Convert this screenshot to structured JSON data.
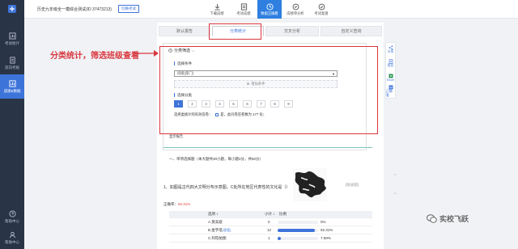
{
  "sidebar": {
    "items": [
      {
        "label": "考试统计",
        "icon": "chart-icon"
      },
      {
        "label": "双向考核",
        "icon": "document-icon"
      },
      {
        "label": "成绩&数据",
        "icon": "data-icon",
        "active": true
      }
    ],
    "bottom": [
      {
        "label": "帮助中心",
        "icon": "help-icon"
      },
      {
        "label": "帮助中心",
        "icon": "user-icon"
      }
    ]
  },
  "topbar": {
    "exam_title": "历史九年级全一模综合测试(ID 37473213)",
    "switch_label": "切换考试",
    "tools": [
      {
        "label": "下载成绩",
        "icon": "download-icon"
      },
      {
        "label": "考试成绩",
        "icon": "grade-icon"
      },
      {
        "label": "数据正确看",
        "icon": "clock-icon",
        "active": true
      },
      {
        "label": "成绩单分析",
        "icon": "analysis-icon"
      },
      {
        "label": "考试复盘",
        "icon": "check-icon"
      }
    ]
  },
  "tabs": [
    {
      "label": "默认报告"
    },
    {
      "label": "分类统计",
      "active": true
    },
    {
      "label": "交叉分析"
    },
    {
      "label": "自定义查询"
    }
  ],
  "filter": {
    "header": "分类筛选",
    "condition_label": "选择条件",
    "select_value": "班级(部门)",
    "add_condition": "增加条件",
    "classify_label": "选择分类",
    "numbers": [
      "1",
      "2",
      "3",
      "4",
      "5",
      "6",
      "7",
      "8",
      "9"
    ],
    "active_number": "1",
    "valid_label": "选择类统计的有效答卷：",
    "valid_value": "是，此问卷答卷数为 177 份；"
  },
  "annotation": "分类统计，筛选班级查看",
  "report_mark": "显示报告",
  "section_head": "一、单项选择题（本大题共30小题，每小题2分，共60分）",
  "question": "1、如图是古代四大文明分布示意图，C处所在地区代表性的文化是（）",
  "collect_label": "[收录题]",
  "accuracy": {
    "label": "正确率：",
    "value": "92.31%"
  },
  "table": {
    "headers": [
      "选项 ↕",
      "小计 ↕",
      "比例"
    ],
    "rows": [
      {
        "option": "A.莫高窟",
        "count": "0",
        "pct": "0%",
        "ratio": 0,
        "tag": ""
      },
      {
        "option": "B.金字塔",
        "count": "12",
        "pct": "92.31%",
        "ratio": 0.9231,
        "tag": "(答案)"
      },
      {
        "option": "C.阿旺帕图",
        "count": "1",
        "pct": "7.69%",
        "ratio": 0.0769,
        "tag": ""
      }
    ]
  },
  "right_tools": [
    {
      "label": "分享",
      "icon": "share-icon"
    },
    {
      "label": "报告",
      "icon": "report-icon"
    },
    {
      "label": "Excel",
      "icon": "excel-icon"
    },
    {
      "label": "正确看",
      "icon": "word-icon"
    }
  ],
  "watermark": "实校飞跃",
  "colors": {
    "accent": "#3d74d9",
    "sidebar": "#2a3447",
    "annotation": "#d9363e"
  }
}
